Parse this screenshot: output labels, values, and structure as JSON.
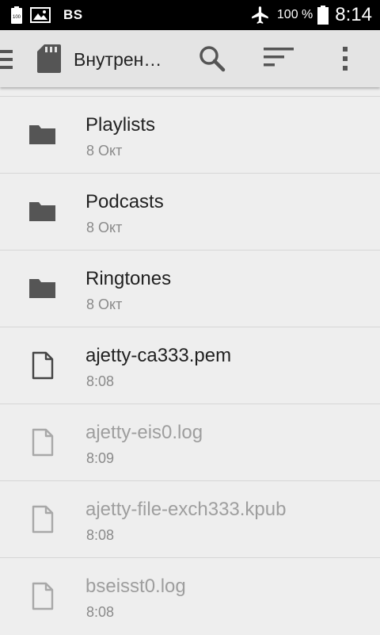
{
  "status_bar": {
    "carrier": "BS",
    "battery_percent": "100 %",
    "time": "8:14",
    "battery_icon_label": "100"
  },
  "toolbar": {
    "title": "Внутрен…",
    "icons": [
      "menu-icon",
      "sd-card-icon",
      "search-icon",
      "sort-icon",
      "more-vert-icon"
    ]
  },
  "files": [
    {
      "name": "Playlists",
      "meta": "8 Окт",
      "type": "folder",
      "dimmed": false
    },
    {
      "name": "Podcasts",
      "meta": "8 Окт",
      "type": "folder",
      "dimmed": false
    },
    {
      "name": "Ringtones",
      "meta": "8 Окт",
      "type": "folder",
      "dimmed": false
    },
    {
      "name": "ajetty-ca333.pem",
      "meta": "8:08",
      "type": "file",
      "dimmed": false
    },
    {
      "name": "ajetty-eis0.log",
      "meta": "8:09",
      "type": "file",
      "dimmed": true
    },
    {
      "name": "ajetty-file-exch333.kpub",
      "meta": "8:08",
      "type": "file",
      "dimmed": true
    },
    {
      "name": "bseisst0.log",
      "meta": "8:08",
      "type": "file",
      "dimmed": true
    }
  ],
  "colors": {
    "status_bar_bg": "#000000",
    "toolbar_bg": "#e4e4e4",
    "list_bg": "#eeeeee",
    "folder_icon": "#555555",
    "file_icon_active": "#444444",
    "file_icon_dim": "#a8a8a8"
  }
}
